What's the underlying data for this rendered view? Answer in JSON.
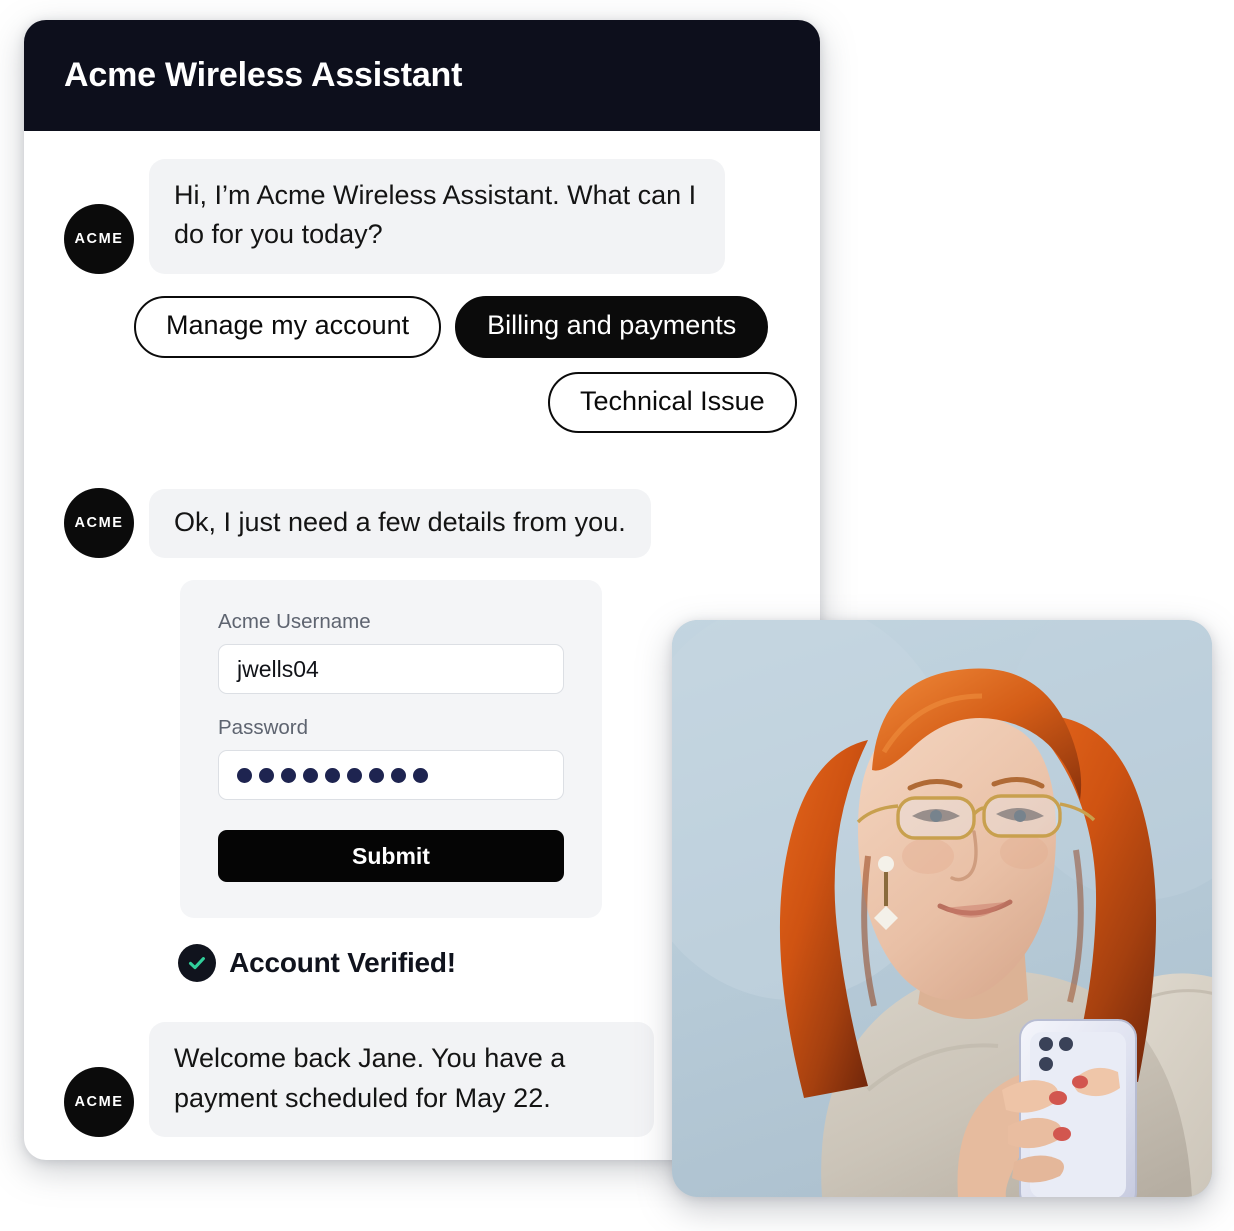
{
  "header": {
    "title": "Acme Wireless Assistant"
  },
  "avatar": {
    "label": "ACME",
    "name": "acme-avatar"
  },
  "messages": [
    {
      "id": "greeting",
      "text": "Hi, I’m Acme Wireless Assistant. What can I do for you today?"
    },
    {
      "id": "details-request",
      "text": "Ok, I just need a few details from you."
    },
    {
      "id": "welcome-back",
      "text": "Welcome back Jane. You have a payment scheduled for May 22."
    }
  ],
  "quick_replies": [
    {
      "label": "Manage my account",
      "selected": false
    },
    {
      "label": "Billing and payments",
      "selected": true
    },
    {
      "label": "Technical Issue",
      "selected": false
    }
  ],
  "login_form": {
    "username": {
      "label": "Acme Username",
      "value": "jwells04",
      "placeholder": "Acme Username"
    },
    "password": {
      "label": "Password",
      "masked_value": "•••••••••",
      "dot_count": 9,
      "placeholder": "Password"
    },
    "submit_label": "Submit"
  },
  "status": {
    "verified_label": "Account Verified!",
    "check_icon": "check-circle-icon"
  },
  "colors": {
    "header_bg": "#0d0f1c",
    "accent_black": "#0b0b0b",
    "bubble_bg": "#f2f3f5",
    "form_bg": "#f4f5f7",
    "success_green": "#31cf9b",
    "password_dot": "#1e2450",
    "photo_bg": "#b9cdda"
  },
  "photo": {
    "alt": "Woman with red hair and glasses using a smartphone",
    "name": "customer-photo"
  }
}
